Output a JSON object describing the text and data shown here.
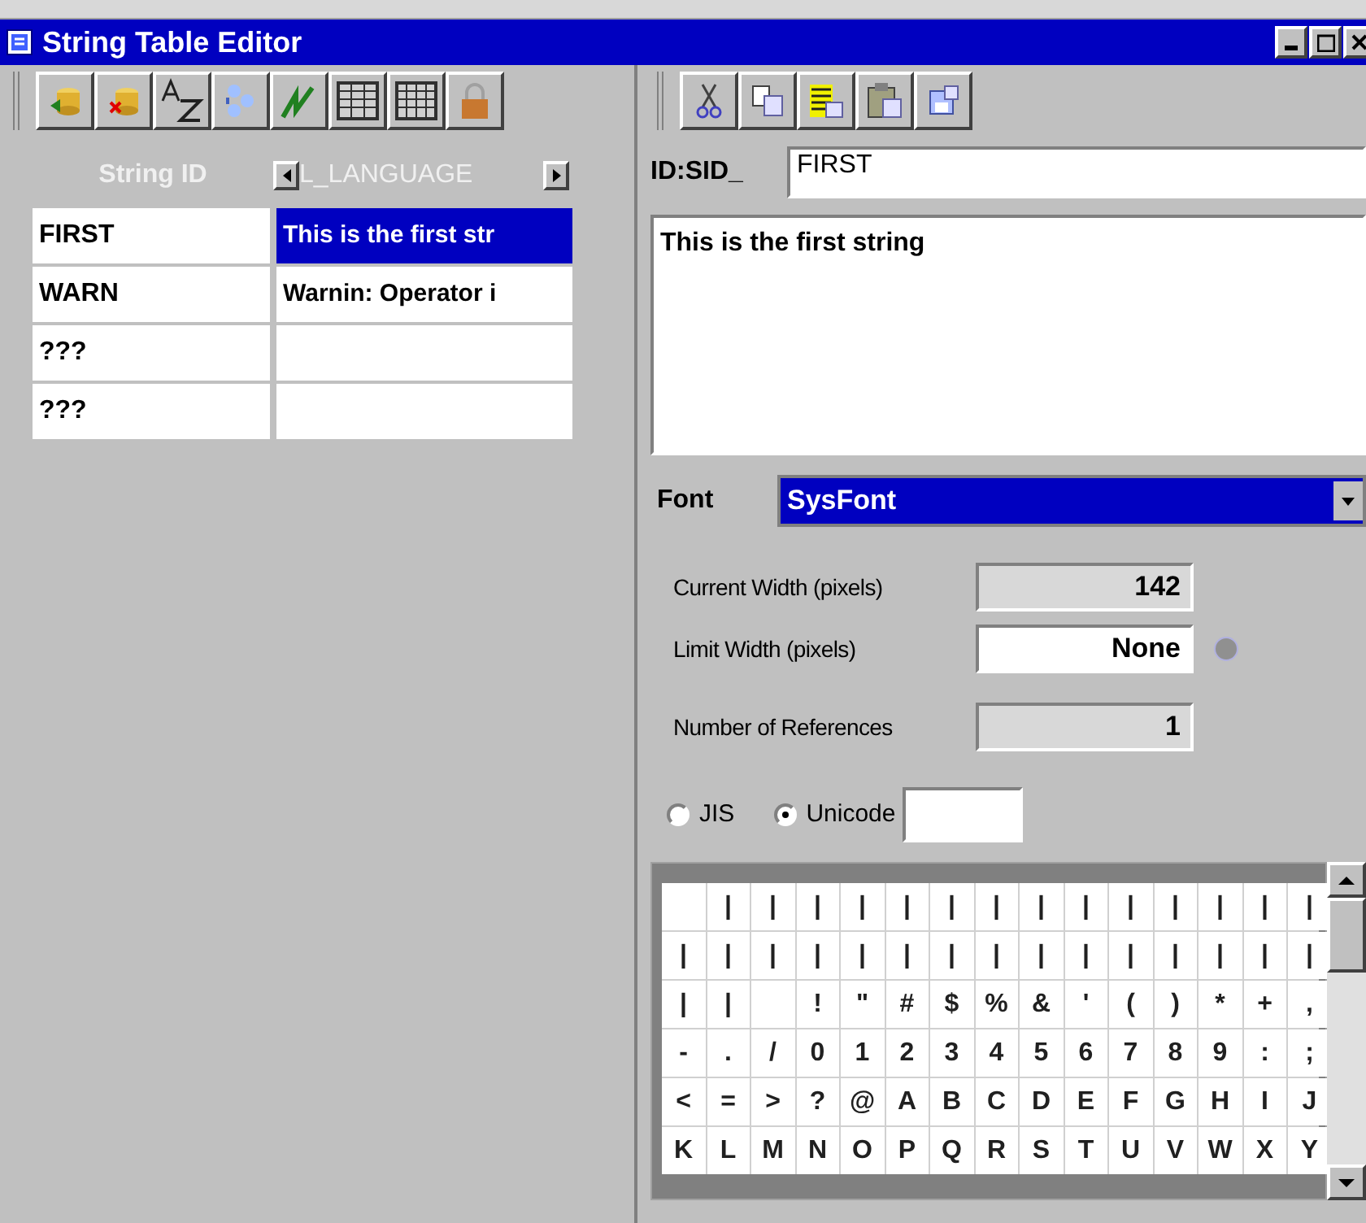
{
  "window": {
    "title": "String Table Editor"
  },
  "left_panel": {
    "table": {
      "columns": [
        "String ID",
        "L_LANGUAGE"
      ],
      "rows": [
        {
          "id": "FIRST",
          "text": "This is the first str",
          "selected": true
        },
        {
          "id": "WARN",
          "text": "Warnin: Operator i",
          "selected": false
        },
        {
          "id": "???",
          "selected": false
        },
        {
          "id": "???",
          "selected": false
        }
      ]
    }
  },
  "right_panel": {
    "id_label": "ID:SID_",
    "id_value": "FIRST",
    "string_value": "This is the first string",
    "font": {
      "label": "Font",
      "value": "SysFont"
    },
    "current_width": {
      "label": "Current Width (pixels)",
      "value": "142"
    },
    "limit_width": {
      "label": "Limit Width (pixels)",
      "value": "None"
    },
    "references": {
      "label": "Number of References",
      "value": "1"
    },
    "encodings": [
      {
        "label": "JIS",
        "selected": false
      },
      {
        "label": "Unicode",
        "selected": true
      }
    ],
    "char_grid": [
      [
        {
          "kind": "blank"
        },
        "|",
        "|",
        "|",
        "|",
        "|",
        "|",
        "|",
        "|",
        "|",
        "|",
        "|",
        "|",
        "|",
        "|"
      ],
      [
        "|",
        "|",
        "|",
        "|",
        "|",
        "|",
        "|",
        "|",
        "|",
        "|",
        "|",
        "|",
        "|",
        "|",
        "|"
      ],
      [
        "|",
        "|",
        {
          "kind": "blank"
        },
        "!",
        "\"",
        "#",
        "$",
        "%",
        "&",
        "'",
        "(",
        ")",
        "*",
        "+",
        ","
      ],
      [
        "-",
        ".",
        "/",
        "0",
        "1",
        "2",
        "3",
        "4",
        "5",
        "6",
        "7",
        "8",
        "9",
        ":",
        ";"
      ],
      [
        "<",
        "=",
        ">",
        "?",
        "@",
        "A",
        "B",
        "C",
        "D",
        "E",
        "F",
        "G",
        "H",
        "I",
        "J"
      ],
      [
        "K",
        "L",
        "M",
        "N",
        "O",
        "P",
        "Q",
        "R",
        "S",
        "T",
        "U",
        "V",
        "W",
        "X",
        "Y"
      ]
    ]
  }
}
